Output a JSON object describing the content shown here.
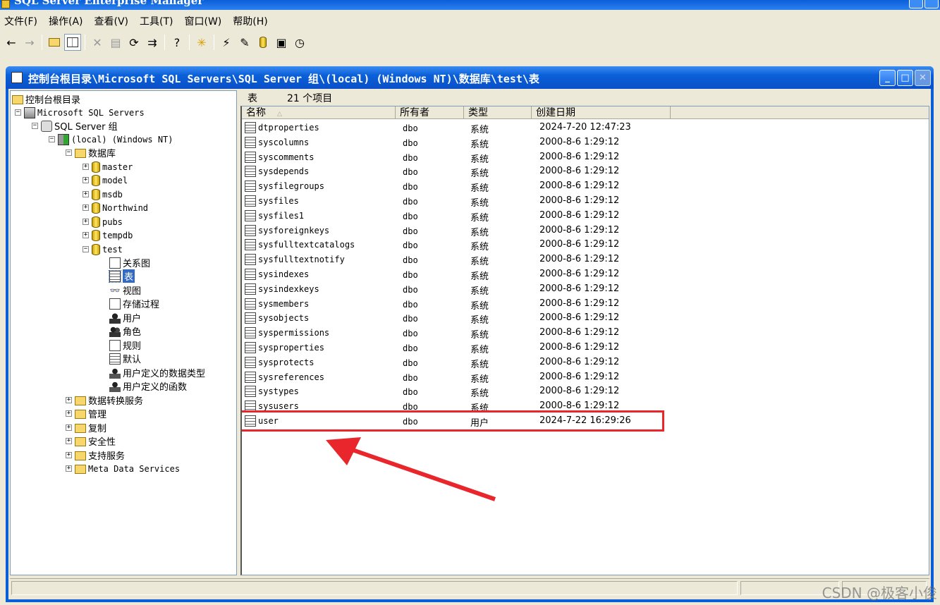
{
  "app": {
    "title": "SQL Server Enterprise Manager"
  },
  "menu": [
    "文件(F)",
    "操作(A)",
    "查看(V)",
    "工具(T)",
    "窗口(W)",
    "帮助(H)"
  ],
  "child_window": {
    "title": "控制台根目录\\Microsoft SQL Servers\\SQL Server 组\\(local) (Windows NT)\\数据库\\test\\表",
    "min_label": "_",
    "max_label": "□",
    "close_label": "✕"
  },
  "tree": {
    "root": "控制台根目录",
    "servers": "Microsoft SQL Servers",
    "group": "SQL Server 组",
    "local": "(local) (Windows NT)",
    "databases": "数据库",
    "dbs": [
      "master",
      "model",
      "msdb",
      "Northwind",
      "pubs",
      "tempdb",
      "test"
    ],
    "test_children": [
      "关系图",
      "表",
      "视图",
      "存储过程",
      "用户",
      "角色",
      "规则",
      "默认",
      "用户定义的数据类型",
      "用户定义的函数"
    ],
    "server_nodes": [
      "数据转换服务",
      "管理",
      "复制",
      "安全性",
      "支持服务",
      "Meta Data Services"
    ],
    "expander_plus": "+",
    "expander_minus": "−"
  },
  "list": {
    "header_title": "表",
    "header_count": "21 个项目",
    "columns": [
      "名称",
      "所有者",
      "类型",
      "创建日期"
    ],
    "sort_indicator": "△",
    "rows": [
      {
        "name": "dtproperties",
        "owner": "dbo",
        "type": "系统",
        "date": "2024-7-20 12:47:23"
      },
      {
        "name": "syscolumns",
        "owner": "dbo",
        "type": "系统",
        "date": "2000-8-6 1:29:12"
      },
      {
        "name": "syscomments",
        "owner": "dbo",
        "type": "系统",
        "date": "2000-8-6 1:29:12"
      },
      {
        "name": "sysdepends",
        "owner": "dbo",
        "type": "系统",
        "date": "2000-8-6 1:29:12"
      },
      {
        "name": "sysfilegroups",
        "owner": "dbo",
        "type": "系统",
        "date": "2000-8-6 1:29:12"
      },
      {
        "name": "sysfiles",
        "owner": "dbo",
        "type": "系统",
        "date": "2000-8-6 1:29:12"
      },
      {
        "name": "sysfiles1",
        "owner": "dbo",
        "type": "系统",
        "date": "2000-8-6 1:29:12"
      },
      {
        "name": "sysforeignkeys",
        "owner": "dbo",
        "type": "系统",
        "date": "2000-8-6 1:29:12"
      },
      {
        "name": "sysfulltextcatalogs",
        "owner": "dbo",
        "type": "系统",
        "date": "2000-8-6 1:29:12"
      },
      {
        "name": "sysfulltextnotify",
        "owner": "dbo",
        "type": "系统",
        "date": "2000-8-6 1:29:12"
      },
      {
        "name": "sysindexes",
        "owner": "dbo",
        "type": "系统",
        "date": "2000-8-6 1:29:12"
      },
      {
        "name": "sysindexkeys",
        "owner": "dbo",
        "type": "系统",
        "date": "2000-8-6 1:29:12"
      },
      {
        "name": "sysmembers",
        "owner": "dbo",
        "type": "系统",
        "date": "2000-8-6 1:29:12"
      },
      {
        "name": "sysobjects",
        "owner": "dbo",
        "type": "系统",
        "date": "2000-8-6 1:29:12"
      },
      {
        "name": "syspermissions",
        "owner": "dbo",
        "type": "系统",
        "date": "2000-8-6 1:29:12"
      },
      {
        "name": "sysproperties",
        "owner": "dbo",
        "type": "系统",
        "date": "2000-8-6 1:29:12"
      },
      {
        "name": "sysprotects",
        "owner": "dbo",
        "type": "系统",
        "date": "2000-8-6 1:29:12"
      },
      {
        "name": "sysreferences",
        "owner": "dbo",
        "type": "系统",
        "date": "2000-8-6 1:29:12"
      },
      {
        "name": "systypes",
        "owner": "dbo",
        "type": "系统",
        "date": "2000-8-6 1:29:12"
      },
      {
        "name": "sysusers",
        "owner": "dbo",
        "type": "系统",
        "date": "2000-8-6 1:29:12"
      },
      {
        "name": "user",
        "owner": "dbo",
        "type": "用户",
        "date": "2024-7-22 16:29:26"
      }
    ]
  },
  "annotation": {
    "highlight_color": "#e8262c"
  },
  "watermark": "CSDN @极客小俊",
  "colors": {
    "titlebar": "#0a5fd8",
    "selection": "#316ac5",
    "window_bg": "#ece9d8"
  }
}
